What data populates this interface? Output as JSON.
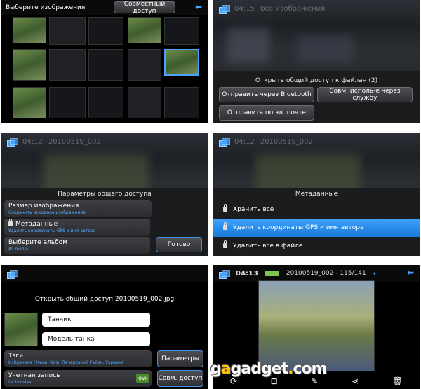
{
  "p1": {
    "title": "Выберите изображения",
    "share_button": "Совместный доступ"
  },
  "p2": {
    "status_time": "04:15",
    "status_label": "Все изображения",
    "sheet_title": "Открыть общий доступ к файлан (2)",
    "btn_bluetooth": "Отправить через Bluetooth",
    "btn_service": "Совм. исполь-е через службу",
    "btn_email": "Отправить по эл. почте"
  },
  "p3": {
    "status_time": "04:12",
    "status_file": "20100519_002",
    "sheet_title": "Параметры общего доступа",
    "rows": [
      {
        "title": "Размер изображения",
        "sub": "Сохранить исходное изображение"
      },
      {
        "title": "Метаданные",
        "sub": "Удалить координаты GPS и имя автора"
      },
      {
        "title": "Выберите альбом",
        "sub": "All media"
      }
    ],
    "done_button": "Готово"
  },
  "p4": {
    "status_time": "04:12",
    "status_file": "20100519_002",
    "sheet_title": "Метаданные",
    "items": [
      "Хранить все",
      "Удалить координаты GPS и имя автора",
      "Удалить все в файле"
    ]
  },
  "p5": {
    "title": "Открыть общий доступ 20100519_002.jpg",
    "field1": "Танчик",
    "field2": "Модель танка",
    "tags_title": "Тэги",
    "tags_sub": "Избранное | Киев, Киiв, Печерський Район, Украина",
    "account_title": "Учетная запись",
    "account_sub": "technoslav",
    "account_badge": "ovi",
    "params_button": "Параметры",
    "share_button": "Совм. доступ"
  },
  "p6": {
    "time": "04:13",
    "file": "20100519_002 - 115/141"
  },
  "watermark": {
    "pre": "g",
    "a": "a",
    "mid": "gadget",
    "dot": ".",
    "com": "com"
  }
}
